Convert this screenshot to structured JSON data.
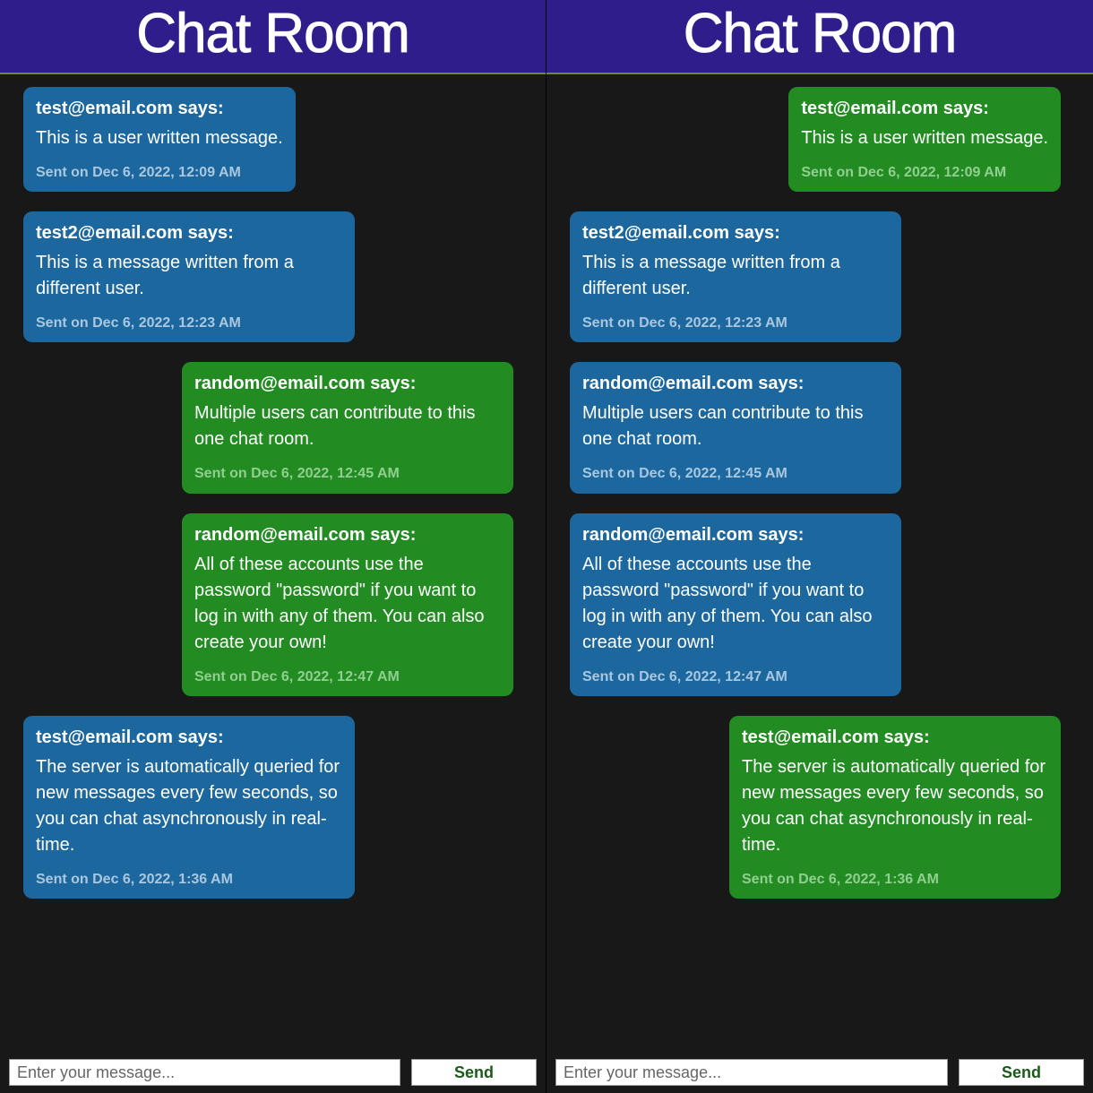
{
  "header_title": "Chat Room",
  "says_suffix": " says:",
  "ts_prefix": "Sent on ",
  "composer": {
    "placeholder": "Enter your message...",
    "send_label": "Send"
  },
  "panes": {
    "left": {
      "messages": [
        {
          "sender": "test@email.com",
          "body": "This is a user written message.",
          "ts": "Dec 6, 2022, 12:09 AM",
          "color": "blue",
          "align": "left"
        },
        {
          "sender": "test2@email.com",
          "body": "This is a message written from a different user.",
          "ts": "Dec 6, 2022, 12:23 AM",
          "color": "blue",
          "align": "left"
        },
        {
          "sender": "random@email.com",
          "body": "Multiple users can contribute to this one chat room.",
          "ts": "Dec 6, 2022, 12:45 AM",
          "color": "green",
          "align": "right"
        },
        {
          "sender": "random@email.com",
          "body": "All of these accounts use the password \"password\" if you want to log in with any of them. You can also create your own!",
          "ts": "Dec 6, 2022, 12:47 AM",
          "color": "green",
          "align": "right"
        },
        {
          "sender": "test@email.com",
          "body": "The server is automatically queried for new messages every few seconds, so you can chat asynchronously in real-time.",
          "ts": "Dec 6, 2022, 1:36 AM",
          "color": "blue",
          "align": "left"
        }
      ]
    },
    "right": {
      "messages": [
        {
          "sender": "test@email.com",
          "body": "This is a user written message.",
          "ts": "Dec 6, 2022, 12:09 AM",
          "color": "green",
          "align": "right"
        },
        {
          "sender": "test2@email.com",
          "body": "This is a message written from a different user.",
          "ts": "Dec 6, 2022, 12:23 AM",
          "color": "blue",
          "align": "left"
        },
        {
          "sender": "random@email.com",
          "body": "Multiple users can contribute to this one chat room.",
          "ts": "Dec 6, 2022, 12:45 AM",
          "color": "blue",
          "align": "left"
        },
        {
          "sender": "random@email.com",
          "body": "All of these accounts use the password \"password\" if you want to log in with any of them. You can also create your own!",
          "ts": "Dec 6, 2022, 12:47 AM",
          "color": "blue",
          "align": "left"
        },
        {
          "sender": "test@email.com",
          "body": "The server is automatically queried for new messages every few seconds, so you can chat asynchronously in real-time.",
          "ts": "Dec 6, 2022, 1:36 AM",
          "color": "green",
          "align": "right"
        }
      ]
    }
  }
}
